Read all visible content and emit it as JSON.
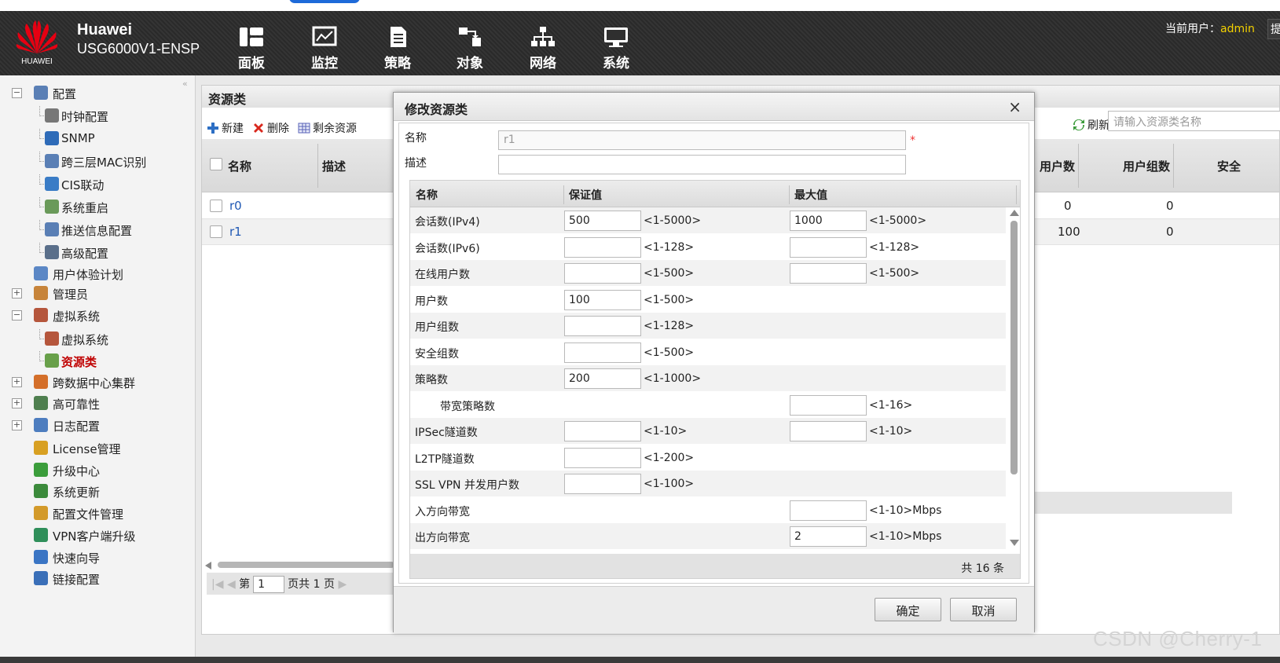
{
  "brand": {
    "logo_text": "HUAWEI",
    "name": "Huawei",
    "model": "USG6000V1-ENSP"
  },
  "nav": [
    {
      "label": "面板",
      "icon": "dashboard-icon"
    },
    {
      "label": "监控",
      "icon": "monitor-icon"
    },
    {
      "label": "策略",
      "icon": "policy-icon"
    },
    {
      "label": "对象",
      "icon": "object-icon"
    },
    {
      "label": "网络",
      "icon": "network-icon"
    },
    {
      "label": "系统",
      "icon": "system-icon"
    }
  ],
  "user": {
    "label": "当前用户：",
    "name": "admin",
    "more": "提"
  },
  "sidebar": {
    "items": [
      {
        "label": "配置",
        "expander": "−"
      },
      {
        "label": "时钟配置"
      },
      {
        "label": "SNMP"
      },
      {
        "label": "跨三层MAC识别"
      },
      {
        "label": "CIS联动"
      },
      {
        "label": "系统重启"
      },
      {
        "label": "推送信息配置"
      },
      {
        "label": "高级配置"
      },
      {
        "label": "用户体验计划"
      },
      {
        "label": "管理员",
        "expander": "+"
      },
      {
        "label": "虚拟系统",
        "expander": "−"
      },
      {
        "label": "虚拟系统"
      },
      {
        "label": "资源类",
        "selected": true
      },
      {
        "label": "跨数据中心集群",
        "expander": "+"
      },
      {
        "label": "高可靠性",
        "expander": "+"
      },
      {
        "label": "日志配置",
        "expander": "+"
      },
      {
        "label": "License管理"
      },
      {
        "label": "升级中心"
      },
      {
        "label": "系统更新"
      },
      {
        "label": "配置文件管理"
      },
      {
        "label": "VPN客户端升级"
      },
      {
        "label": "快速向导"
      },
      {
        "label": "链接配置"
      }
    ]
  },
  "panel": {
    "title": "资源类",
    "toolbar": {
      "new": "新建",
      "delete": "删除",
      "remaining": "剩余资源",
      "refresh": "刷新"
    },
    "search_placeholder": "请输入资源类名称",
    "columns": {
      "name": "名称",
      "desc": "描述",
      "users": "用户数",
      "user_groups": "用户组数",
      "security": "安全"
    },
    "rows": [
      {
        "name": "r0",
        "users": "0",
        "user_groups": "0"
      },
      {
        "name": "r1",
        "users": "100",
        "user_groups": "0"
      }
    ],
    "pager": {
      "prefix": "第",
      "page": "1",
      "suffix": "页共 1 页"
    }
  },
  "dialog": {
    "title": "修改资源类",
    "close": "×",
    "name_label": "名称",
    "name_value": "r1",
    "required_mark": "*",
    "desc_label": "描述",
    "desc_value": "",
    "table_headers": {
      "name": "名称",
      "guarantee": "保证值",
      "max": "最大值"
    },
    "rows": [
      {
        "name": "会话数(IPv4)",
        "g": "500",
        "g_range": "<1-5000>",
        "m": "1000",
        "m_range": "<1-5000>"
      },
      {
        "name": "会话数(IPv6)",
        "g": "",
        "g_range": "<1-128>",
        "m": "",
        "m_range": "<1-128>"
      },
      {
        "name": "在线用户数",
        "g": "",
        "g_range": "<1-500>",
        "m": "",
        "m_range": "<1-500>"
      },
      {
        "name": "用户数",
        "g": "100",
        "g_range": "<1-500>"
      },
      {
        "name": "用户组数",
        "g": "",
        "g_range": "<1-128>"
      },
      {
        "name": "安全组数",
        "g": "",
        "g_range": "<1-500>"
      },
      {
        "name": "策略数",
        "g": "200",
        "g_range": "<1-1000>"
      },
      {
        "name": "带宽策略数",
        "indent": true,
        "m": "",
        "m_range": "<1-16>"
      },
      {
        "name": "IPSec隧道数",
        "g": "",
        "g_range": "<1-10>",
        "m": "",
        "m_range": "<1-10>"
      },
      {
        "name": "L2TP隧道数",
        "g": "",
        "g_range": "<1-200>"
      },
      {
        "name": "SSL VPN 并发用户数",
        "g": "",
        "g_range": "<1-100>"
      },
      {
        "name": "入方向带宽",
        "m": "",
        "m_range": "<1-10>Mbps"
      },
      {
        "name": "出方向带宽",
        "m": "2",
        "m_range": "<1-10>Mbps"
      }
    ],
    "total": "共 16 条",
    "ok": "确定",
    "cancel": "取消"
  },
  "watermark": "CSDN @Cherry-1"
}
